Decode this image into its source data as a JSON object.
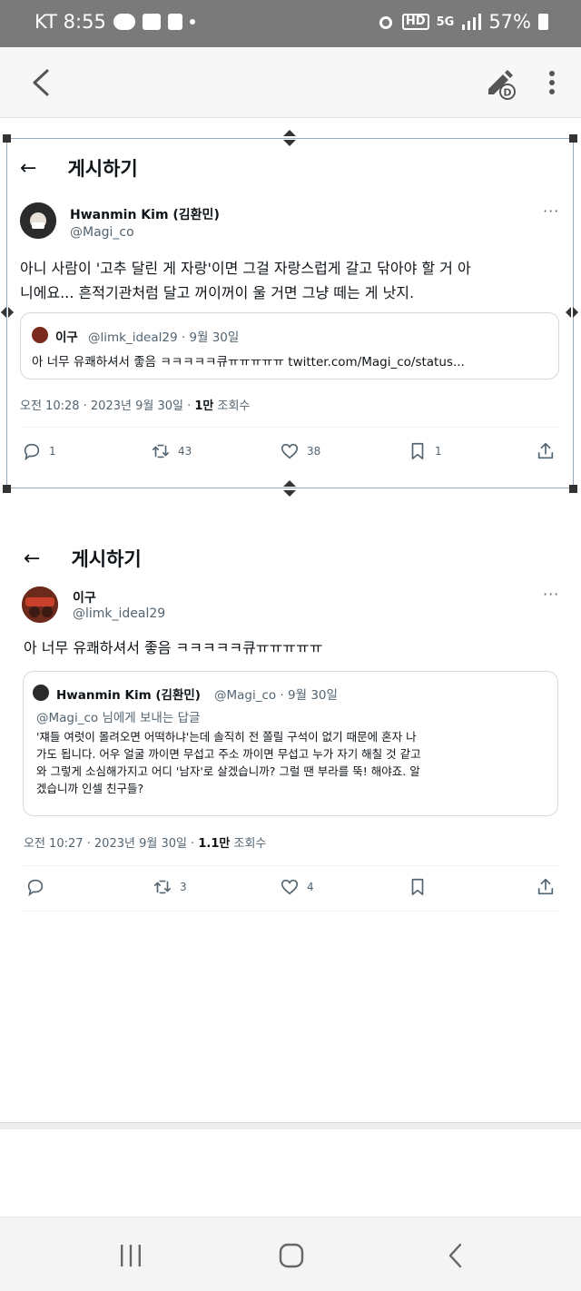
{
  "status_bar": {
    "carrier_time": "KT 8:55",
    "network": "5G",
    "battery": "57%",
    "icons": [
      "talk-icon",
      "gallery-icon",
      "document-icon",
      "alarm-icon",
      "hd-icon",
      "signal-icon",
      "battery-icon"
    ]
  },
  "app_bar": {
    "icons": [
      "back-arrow-icon",
      "edit-icon",
      "more-vert-icon"
    ]
  },
  "post1": {
    "header_title": "게시하기",
    "author_name": "Hwanmin Kim (김환민)",
    "author_handle": "@Magi_co",
    "body_line1": "아니 사람이 '고추 달린 게 자랑'이면 그걸 자랑스럽게 갈고 닦아야 할 거 아",
    "body_line2": "니에요... 흔적기관처럼 달고 꺼이꺼이 울 거면 그냥 떼는 게 낫지.",
    "quote": {
      "name": "이구",
      "meta": "@limk_ideal29 · 9월 30일",
      "text": "아 너무 유쾌하셔서 좋음 ㅋㅋㅋㅋㅋ큐ㅠㅠㅠㅠㅠ twitter.com/Magi_co/status..."
    },
    "meta_prefix": "오전 10:28 · 2023년 9월 30일 · ",
    "views": "1만",
    "views_label": " 조회수",
    "actions": {
      "reply": "1",
      "retweet": "43",
      "like": "38",
      "bookmark": "1"
    }
  },
  "post2": {
    "header_title": "게시하기",
    "author_name": "이구",
    "author_handle": "@limk_ideal29",
    "body": "아 너무 유쾌하셔서 좋음 ㅋㅋㅋㅋㅋ큐ㅠㅠㅠㅠㅠ",
    "quote": {
      "name": "Hwanmin Kim (김환민)",
      "meta": "@Magi_co · 9월 30일",
      "reply_to": "@Magi_co 님에게 보내는 답글",
      "line1": "'쟤들 여럿이 몰려오면 어떡하냐'는데 솔직히 전 쫄릴 구석이 없기 때문에 혼자 나",
      "line2": "가도 됩니다. 어우 얼굴 까이면 무섭고 주소 까이면 무섭고 누가 자기 해칠 것 같고",
      "line3": "와 그렇게 소심해가지고 어디 '남자'로 살겠습니까? 그럴 땐 부라를 뚝! 해야죠. 알",
      "line4": "겠습니까 인셀 친구들?"
    },
    "meta_prefix": "오전 10:27 · 2023년 9월 30일 · ",
    "views": "1.1만",
    "views_label": " 조회수",
    "actions": {
      "retweet": "3",
      "like": "4"
    }
  },
  "nav_bar": {
    "icons": [
      "recent-apps-icon",
      "home-icon",
      "back-icon"
    ]
  }
}
